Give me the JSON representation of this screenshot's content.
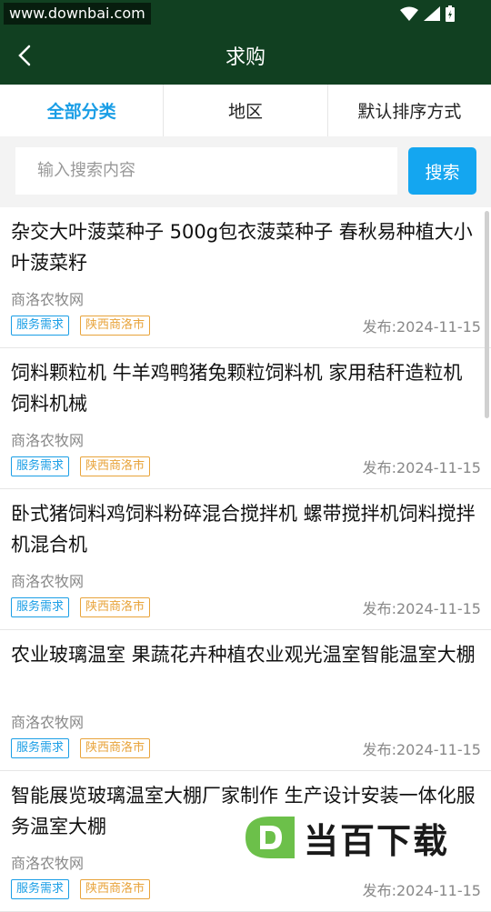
{
  "status": {
    "watermark": "www.downbai.com"
  },
  "header": {
    "title": "求购"
  },
  "filters": [
    {
      "label": "全部分类"
    },
    {
      "label": "地区"
    },
    {
      "label": "默认排序方式"
    }
  ],
  "search": {
    "placeholder": "输入搜索内容",
    "button": "搜索"
  },
  "items": [
    {
      "title": "杂交大叶菠菜种子 500g包衣菠菜种子 春秋易种植大小叶菠菜籽",
      "source": "商洛农牧网",
      "tag1": "服务需求",
      "tag2": "陕西商洛市",
      "date": "发布:2024-11-15"
    },
    {
      "title": "饲料颗粒机 牛羊鸡鸭猪兔颗粒饲料机 家用秸秆造粒机 饲料机械",
      "source": "商洛农牧网",
      "tag1": "服务需求",
      "tag2": "陕西商洛市",
      "date": "发布:2024-11-15"
    },
    {
      "title": "卧式猪饲料鸡饲料粉碎混合搅拌机 螺带搅拌机饲料搅拌机混合机",
      "source": "商洛农牧网",
      "tag1": "服务需求",
      "tag2": "陕西商洛市",
      "date": "发布:2024-11-15"
    },
    {
      "title": "农业玻璃温室 果蔬花卉种植农业观光温室智能温室大棚",
      "source": "商洛农牧网",
      "tag1": "服务需求",
      "tag2": "陕西商洛市",
      "date": "发布:2024-11-15"
    },
    {
      "title": "智能展览玻璃温室大棚厂家制作 生产设计安装一体化服务温室大棚",
      "source": "商洛农牧网",
      "tag1": "服务需求",
      "tag2": "陕西商洛市",
      "date": "发布:2024-11-15"
    }
  ],
  "brand": {
    "text": "当百下载"
  },
  "colors": {
    "appbar": "#114021",
    "accent": "#14a6f0",
    "tag_blue": "#1a9ee6",
    "tag_orange": "#e8a33a"
  }
}
